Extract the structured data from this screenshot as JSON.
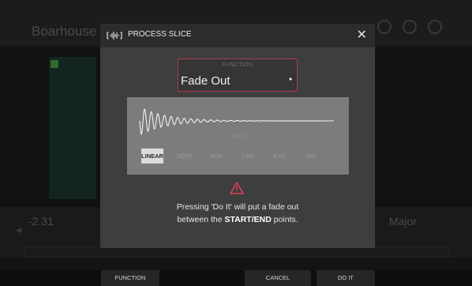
{
  "background": {
    "project_name": "Boarhouse Sy",
    "value_left": "-2.31",
    "value_right": "Major"
  },
  "dialog": {
    "title": "PROCESS SLICE",
    "close_icon": "close-icon",
    "logo_icon": "waveform-logo-icon",
    "function": {
      "label": "FUNCTION",
      "value": "Fade Out",
      "dropdown_icon": "dropdown-dot-icon"
    },
    "curve": {
      "label": "CURVE",
      "types": [
        "LINEAR",
        "SQRT",
        "SQR",
        "LOG",
        "EXP",
        "SIN"
      ],
      "selected": "LINEAR"
    },
    "warning_icon": "warning-triangle-icon",
    "message_line1": "Pressing 'Do It' will put a fade out",
    "message_line2_prefix": "between the ",
    "message_line2_bold": "START/END",
    "message_line2_suffix": " points."
  },
  "bottom_bar": {
    "function_label": "FUNCTION",
    "cancel_label": "CANCEL",
    "doit_label": "DO IT"
  },
  "colors": {
    "accent_border": "#b03a4a",
    "warning": "#d9434f"
  }
}
